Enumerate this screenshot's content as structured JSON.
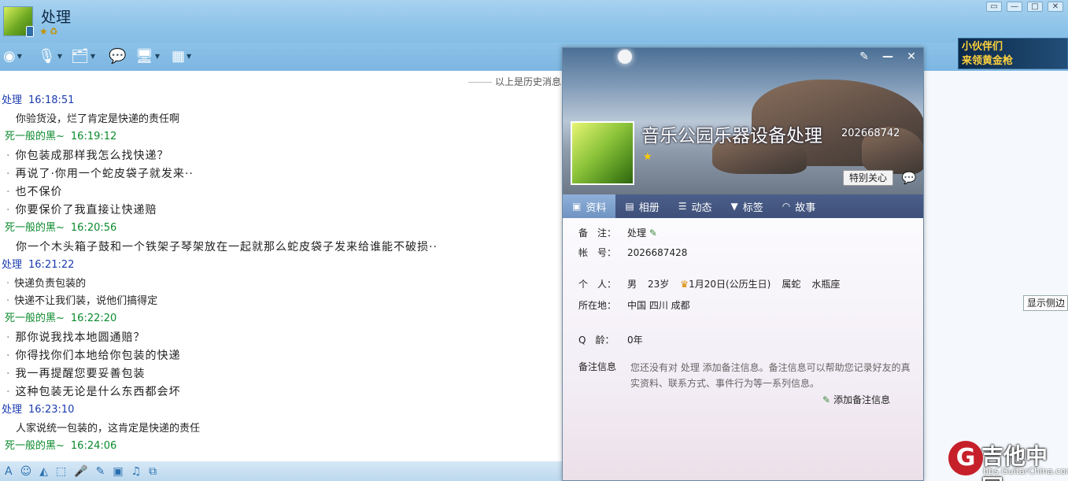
{
  "header": {
    "title": "处理",
    "badges": [
      "★",
      "♻"
    ]
  },
  "toolbar": {
    "icons": [
      "camera-icon",
      "microphone-icon",
      "file-transfer-icon",
      "add-message-icon",
      "remote-desktop-icon",
      "apps-icon"
    ]
  },
  "ad": {
    "line1": "小伙伴们",
    "line2": "来领黄金枪"
  },
  "chat": {
    "history_label": "以上是历史消息",
    "messages": [
      {
        "sender": "处理",
        "time": "16:18:51",
        "lines": [
          "你验货没，烂了肯定是快递的责任啊"
        ]
      },
      {
        "sender": "死一般的黑~",
        "time": "16:19:12",
        "lines": [
          "你包装成那样我怎么找快递？",
          "再说了·你用一个蛇皮袋子就发来··",
          "也不保价",
          "你要保价了我直接让快递赔"
        ]
      },
      {
        "sender": "死一般的黑~",
        "time": "16:20:56",
        "lines": [
          "你一个木头箱子鼓和一个铁架子琴架放在一起就那么蛇皮袋子发来给谁能不破损··"
        ]
      },
      {
        "sender": "处理",
        "time": "16:21:22",
        "lines": [
          "快递负责包装的",
          "快递不让我们装，说他们搞得定"
        ]
      },
      {
        "sender": "死一般的黑~",
        "time": "16:22:20",
        "lines": [
          "那你说我找本地圆通赔？",
          "你得找你们本地给你包装的快递",
          "我一再提醒您要妥善包装",
          "这种包装无论是什么东西都会坏"
        ]
      },
      {
        "sender": "处理",
        "time": "16:23:10",
        "lines": [
          "人家说统一包装的，这肯定是快递的责任"
        ]
      },
      {
        "sender": "死一般的黑~",
        "time": "16:24:06",
        "lines": []
      }
    ]
  },
  "profile": {
    "name": "音乐公园乐器设备处理",
    "number_short": "202668742",
    "star": "★",
    "special_button": "特别关心",
    "tabs": [
      "资料",
      "相册",
      "动态",
      "标签",
      "故事"
    ],
    "fields": {
      "remark_label": "备　注：",
      "remark": "处理",
      "account_label": "帐　号：",
      "account": "2026687428",
      "personal_label": "个　人：",
      "gender": "男",
      "age": "23岁",
      "birthday": "1月20日(公历生日)",
      "zodiac": "属蛇",
      "constellation": "水瓶座",
      "location_label": "所在地：",
      "location": "中国 四川 成都",
      "qage_label": "Q　龄：",
      "qage": "0年",
      "note_label": "备注信息",
      "note": "您还没有对 处理 添加备注信息。备注信息可以帮助您记录好友的真实资料、联系方式、事件行为等一系列信息。",
      "add_note": "添加备注信息"
    }
  },
  "side": {
    "show_sidebar": "显示侧边"
  },
  "watermark": {
    "name": "吉他中国",
    "url": "bbs.GuitarChina.com"
  }
}
